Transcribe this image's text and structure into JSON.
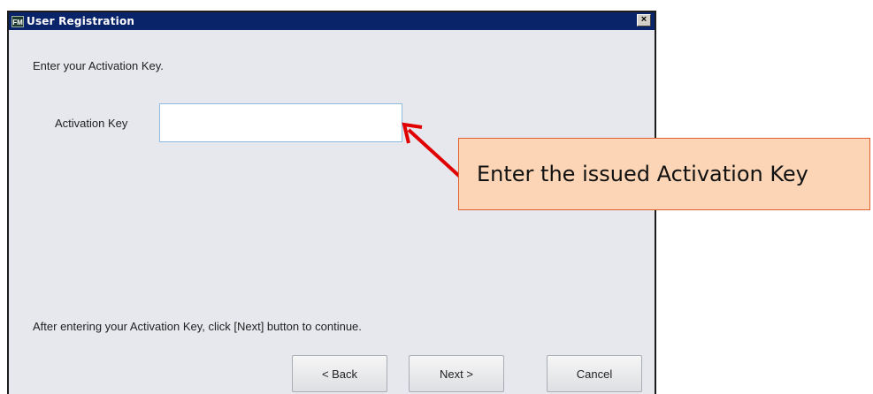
{
  "window": {
    "icon_text": "FM",
    "title": "User Registration",
    "close_glyph": "×"
  },
  "content": {
    "prompt": "Enter your Activation Key.",
    "field_label": "Activation Key",
    "activation_key_value": "",
    "footer_text": "After entering your Activation Key, click [Next] button to continue."
  },
  "buttons": {
    "back": "< Back",
    "next": "Next >",
    "cancel": "Cancel"
  },
  "annotation": {
    "callout_text": "Enter the issued Activation Key",
    "callout_color": "#fbd5b5",
    "arrow_color": "#e00000"
  }
}
